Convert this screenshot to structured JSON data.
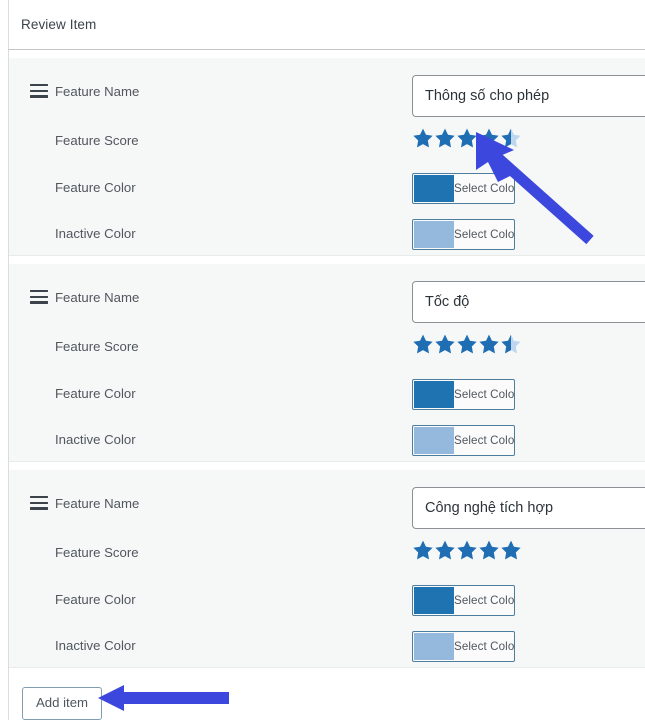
{
  "header": {
    "title": "Review Item"
  },
  "labels": {
    "feature_name": "Feature Name",
    "feature_score": "Feature Score",
    "feature_color": "Feature Color",
    "inactive_color": "Inactive Color",
    "select_color": "Select Color",
    "drag_handle_icon": "drag-handle-icon",
    "star_icon": "star-icon"
  },
  "colors": {
    "feature_color": "#1f73b0",
    "inactive_color": "#94b9dd",
    "star_filled": "#1f6eb4",
    "star_empty": "#bcd7ee",
    "annotation_arrow": "#3b47dd",
    "panel_background": "#f6f7f7",
    "page_background": "#ffffff",
    "label_text": "#50575e",
    "title_text": "#3c434a"
  },
  "input_placeholder": "",
  "items": [
    {
      "name": "Thông số cho phép",
      "score": 4.5,
      "max_score": 5,
      "feature_color": "#1f73b0",
      "inactive_color": "#94b9dd",
      "feature_color_label": "Select Color",
      "inactive_color_label": "Select Color"
    },
    {
      "name": "Tốc độ",
      "score": 4.5,
      "max_score": 5,
      "feature_color": "#1f73b0",
      "inactive_color": "#94b9dd",
      "feature_color_label": "Select Color",
      "inactive_color_label": "Select Color"
    },
    {
      "name": "Công nghệ tích hợp",
      "score": 5,
      "max_score": 5,
      "feature_color": "#1f73b0",
      "inactive_color": "#94b9dd",
      "feature_color_label": "Select Color",
      "inactive_color_label": "Select Color"
    }
  ],
  "footer": {
    "add_item_label": "Add item"
  },
  "annotations": [
    {
      "name": "arrow-pointing-to-feature-score-stars",
      "direction": "up-left",
      "target": "Feature Score stars of item 1"
    },
    {
      "name": "arrow-pointing-to-add-item-button",
      "direction": "left",
      "target": "Add item button"
    }
  ]
}
